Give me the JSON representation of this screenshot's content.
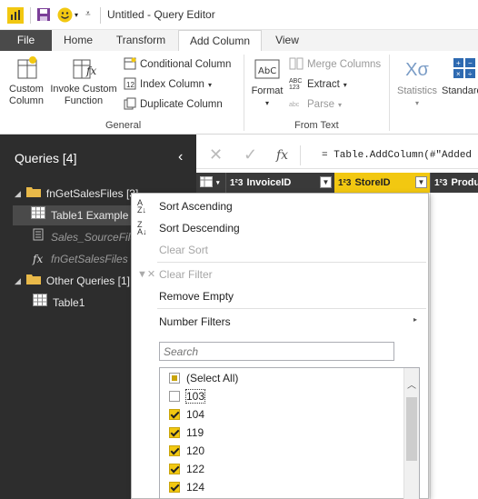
{
  "window": {
    "title": "Untitled - Query Editor"
  },
  "ribbon_tabs": [
    {
      "label": "File"
    },
    {
      "label": "Home"
    },
    {
      "label": "Transform"
    },
    {
      "label": "Add Column"
    },
    {
      "label": "View"
    }
  ],
  "ribbon": {
    "custom_column": "Custom Column",
    "invoke_custom_function": "Invoke Custom Function",
    "conditional_column": "Conditional Column",
    "index_column": "Index Column",
    "duplicate_column": "Duplicate Column",
    "general_group": "General",
    "format": "Format",
    "merge_columns": "Merge Columns",
    "extract": "Extract",
    "parse": "Parse",
    "from_text_group": "From Text",
    "statistics": "Statistics",
    "standard": "Standard"
  },
  "queries": {
    "header": "Queries [4]",
    "items": [
      {
        "label": "fnGetSalesFiles [3]"
      },
      {
        "label": "Table1 Example"
      },
      {
        "label": "Sales_SourceFile"
      },
      {
        "label": "fnGetSalesFiles"
      },
      {
        "label": "Other Queries [1]"
      },
      {
        "label": "Table1"
      }
    ]
  },
  "formula_bar": {
    "formula": "= Table.AddColumn(#\"Added Cu",
    "fx": "fx"
  },
  "columns": [
    {
      "type": "1²3",
      "name": "InvoiceID"
    },
    {
      "type": "1²3",
      "name": "StoreID"
    },
    {
      "type": "1²3",
      "name": "Produ"
    }
  ],
  "menu": {
    "sort_ascending": "Sort Ascending",
    "sort_descending": "Sort Descending",
    "clear_sort": "Clear Sort",
    "clear_filter": "Clear Filter",
    "remove_empty": "Remove Empty",
    "number_filters": "Number Filters",
    "search_placeholder": "Search",
    "values": [
      {
        "label": "(Select All)",
        "state": "partial"
      },
      {
        "label": "103",
        "state": "off"
      },
      {
        "label": "104",
        "state": "on"
      },
      {
        "label": "119",
        "state": "on"
      },
      {
        "label": "120",
        "state": "on"
      },
      {
        "label": "122",
        "state": "on"
      },
      {
        "label": "124",
        "state": "on"
      }
    ]
  },
  "colors": {
    "accent": "#f2c811",
    "dark_pane": "#2d2d2d",
    "file_tab": "#4a4a4a"
  }
}
